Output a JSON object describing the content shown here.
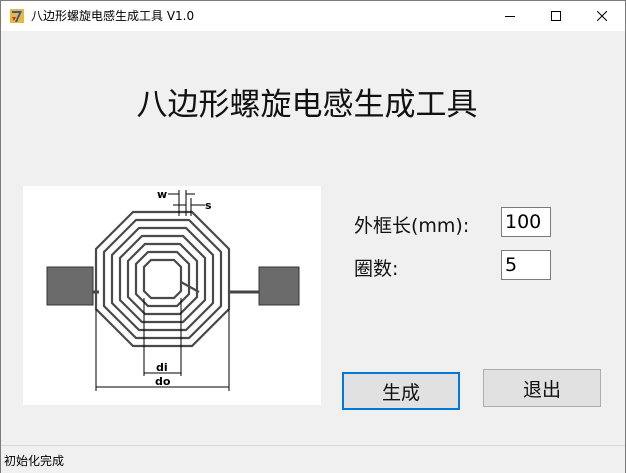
{
  "window": {
    "title": "八边形螺旋电感生成工具 V1.0"
  },
  "main": {
    "heading": "八边形螺旋电感生成工具",
    "diagram_labels": {
      "w": "w",
      "s": "s",
      "di": "di",
      "do": "do"
    }
  },
  "form": {
    "outer_length_label": "外框长(mm):",
    "outer_length_value": "100",
    "turns_label": "圈数:",
    "turns_value": "5"
  },
  "buttons": {
    "generate": "生成",
    "exit": "退出"
  },
  "status": {
    "text": "初始化完成"
  },
  "colors": {
    "accent": "#0078d7",
    "inductor_trace": "#555555",
    "pad": "#6b6b6b"
  }
}
